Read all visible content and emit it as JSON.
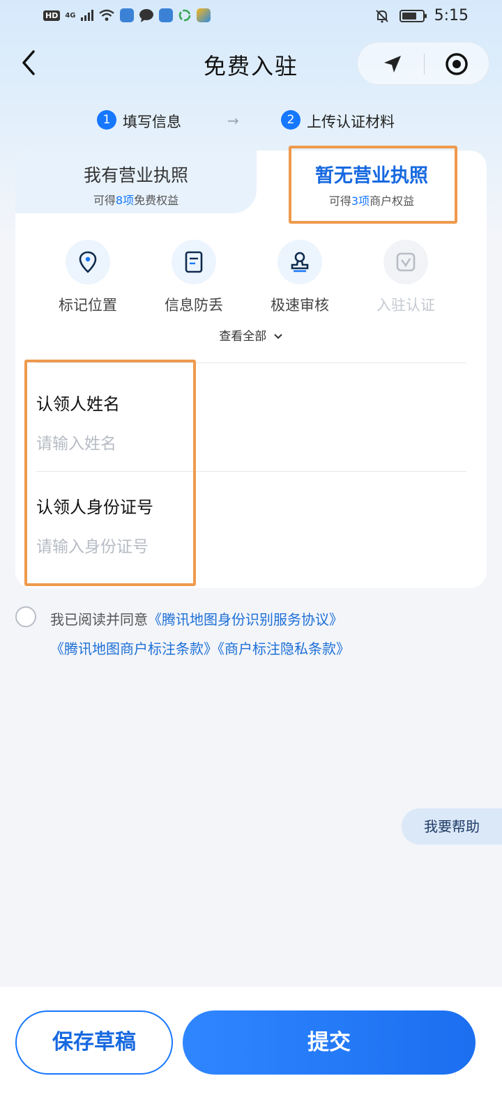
{
  "status_bar": {
    "hd": "HD",
    "network": "4G",
    "time": "5:15",
    "battery_level": 0.72
  },
  "nav": {
    "title": "免费入驻"
  },
  "steps": [
    {
      "num": "1",
      "label": "填写信息"
    },
    {
      "num": "2",
      "label": "上传认证材料"
    }
  ],
  "tabs": {
    "with_license": {
      "title": "我有营业执照",
      "sub_prefix": "可得",
      "sub_num": "8项",
      "sub_suffix": "免费权益"
    },
    "no_license": {
      "title": "暂无营业执照",
      "sub_prefix": "可得",
      "sub_num": "3项",
      "sub_suffix": "商户权益"
    }
  },
  "benefits": [
    {
      "label": "标记位置",
      "icon": "location-pin-icon"
    },
    {
      "label": "信息防丢",
      "icon": "document-icon"
    },
    {
      "label": "极速审核",
      "icon": "stamp-icon"
    },
    {
      "label": "入驻认证",
      "icon": "verified-icon"
    }
  ],
  "see_all": "查看全部",
  "form": {
    "name_label": "认领人姓名",
    "name_placeholder": "请输入姓名",
    "id_label": "认领人身份证号",
    "id_placeholder": "请输入身份证号"
  },
  "agreement": {
    "prefix": "我已阅读并同意",
    "link1": "《腾讯地图身份识别服务协议》",
    "link2": "《腾讯地图商户标注条款》",
    "link3": "《商户标注隐私条款》"
  },
  "help": "我要帮助",
  "buttons": {
    "save_draft": "保存草稿",
    "submit": "提交"
  },
  "colors": {
    "accent": "#1677ff",
    "highlight": "#ee9a4d"
  }
}
